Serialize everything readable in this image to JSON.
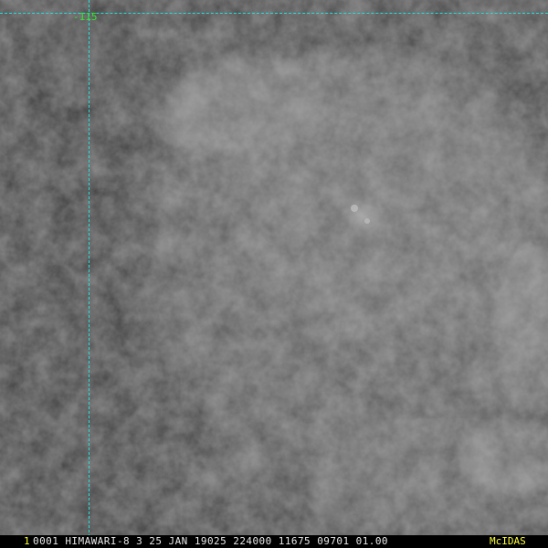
{
  "satellite_view": {
    "grid_label": "-115",
    "status": {
      "frame_number": "1",
      "text": "0001 HIMAWARI-8   3 25 JAN 19025 224000 11675 09701 01.00",
      "software": "McIDAS"
    }
  },
  "colors": {
    "gridline": "#22e0e0",
    "grid_label": "#2ee82e",
    "status_highlight": "#ffff33",
    "status_text": "#e8e8e8"
  }
}
